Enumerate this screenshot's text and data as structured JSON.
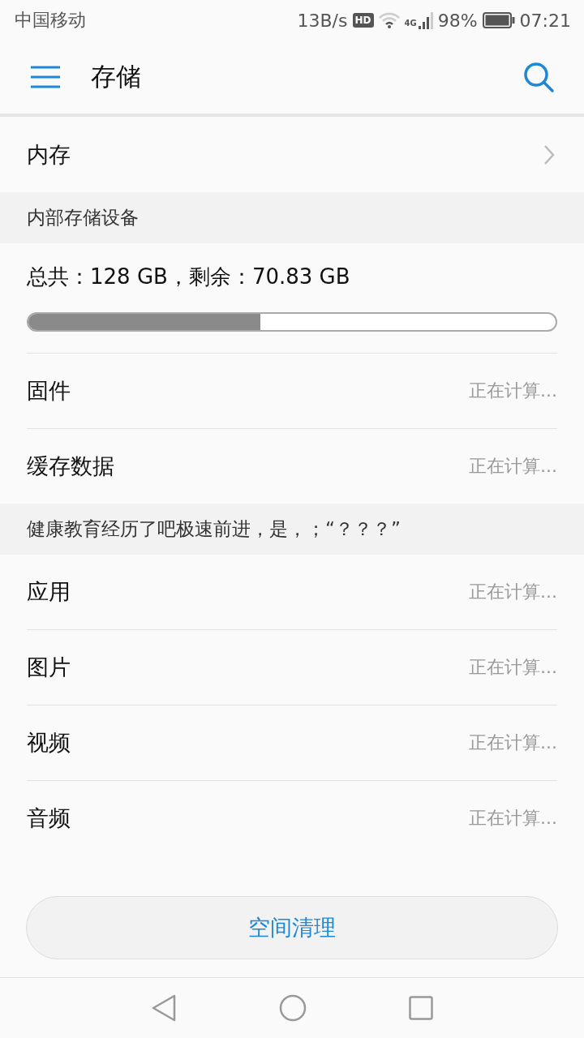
{
  "status_bar": {
    "carrier": "中国移动",
    "speed": "13B/s",
    "hd_badge": "HD",
    "network": "4G",
    "battery": "98%",
    "time": "07:21"
  },
  "app_bar": {
    "title": "存储"
  },
  "memory_row": {
    "label": "内存"
  },
  "sections": [
    {
      "header": "内部存储设备",
      "usage": {
        "text": "总共：128 GB，剩余：70.83 GB",
        "level": 0.44
      },
      "items": [
        {
          "label": "固件",
          "value": "正在计算..."
        },
        {
          "label": "缓存数据",
          "value": "正在计算..."
        }
      ]
    },
    {
      "header": "健康教育经历了吧极速前进，是，；“？？？”",
      "items": [
        {
          "label": "应用",
          "value": "正在计算..."
        },
        {
          "label": "图片",
          "value": "正在计算..."
        },
        {
          "label": "视频",
          "value": "正在计算..."
        },
        {
          "label": "音频",
          "value": "正在计算..."
        }
      ]
    }
  ],
  "clean_button": "空间清理"
}
